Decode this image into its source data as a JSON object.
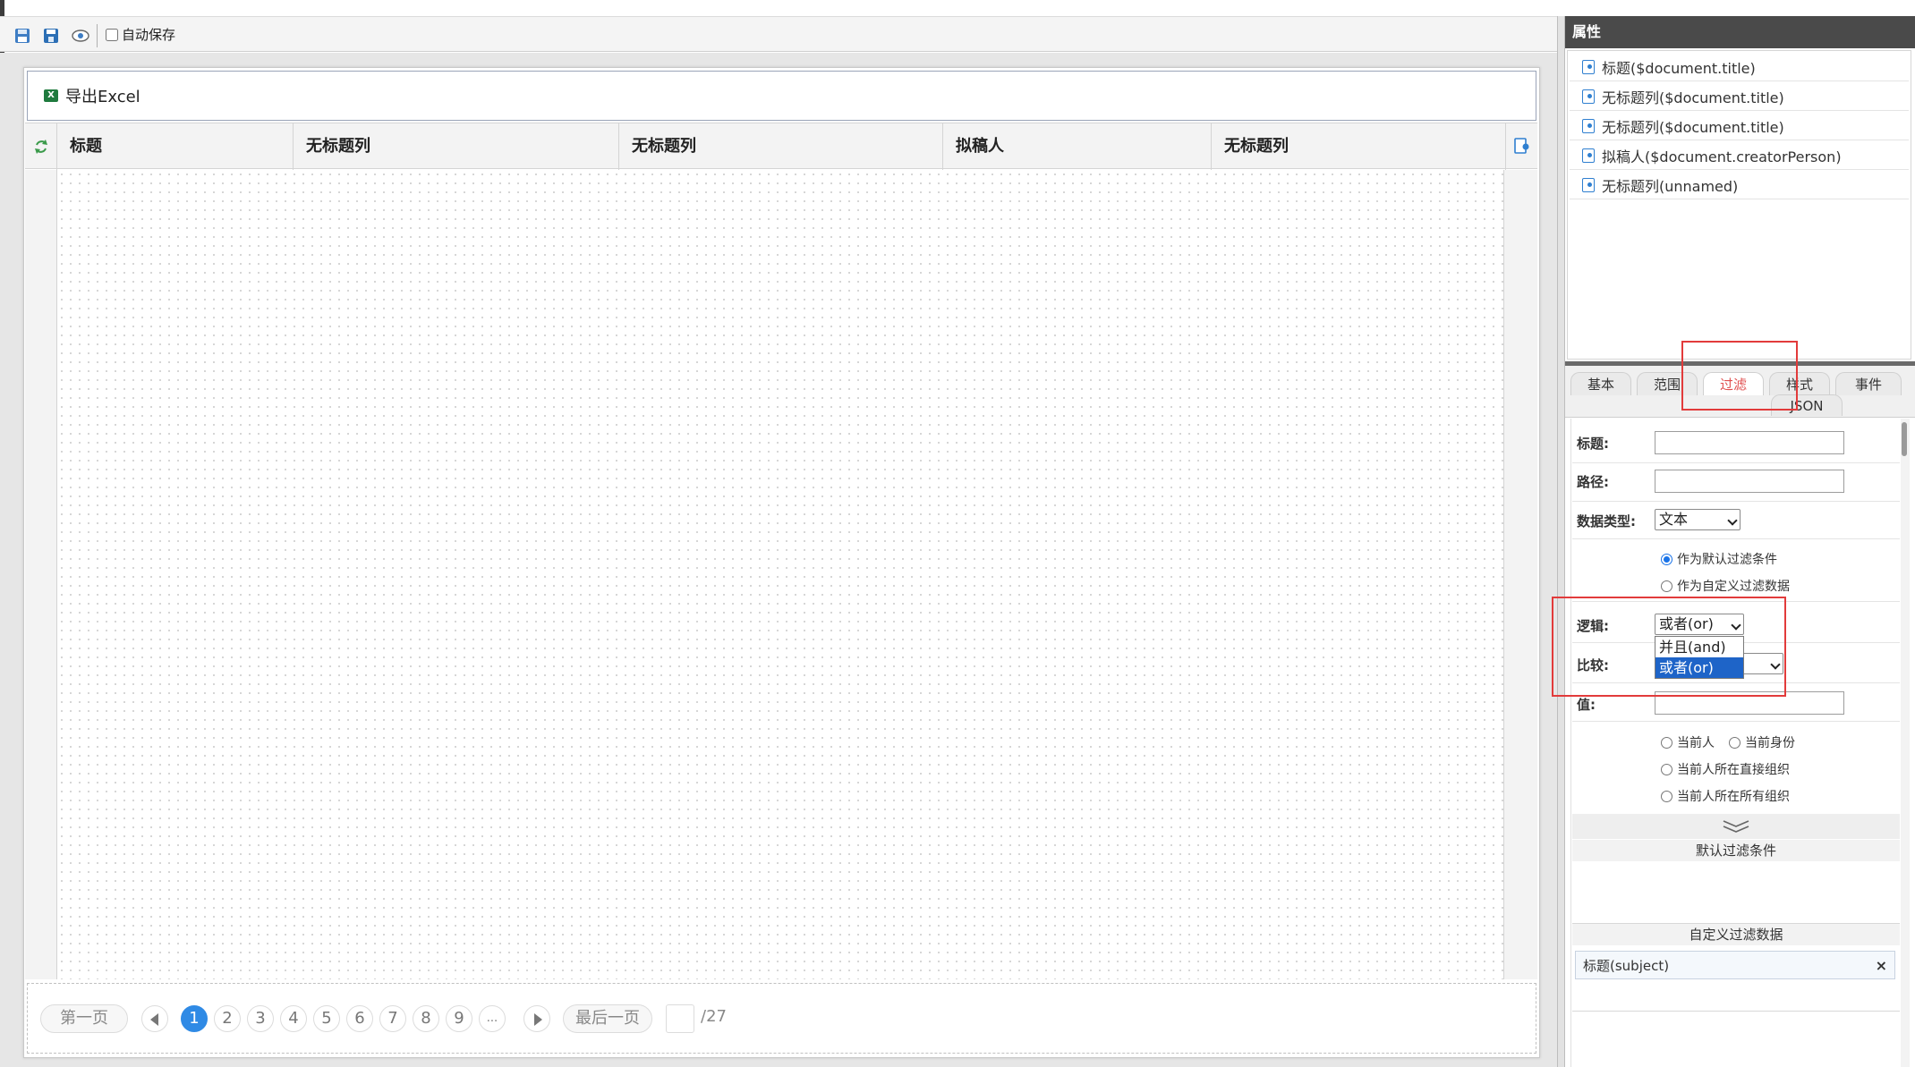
{
  "toolbar": {
    "icons": [
      "save-icon",
      "save-as-icon",
      "preview-icon"
    ],
    "autosave_label": "自动保存",
    "autosave_checked": false
  },
  "view": {
    "export_label": "导出Excel",
    "columns": [
      "标题",
      "无标题列",
      "无标题列",
      "拟稿人",
      "无标题列"
    ]
  },
  "pager": {
    "first": "第一页",
    "last": "最后一页",
    "pages": [
      "1",
      "2",
      "3",
      "4",
      "5",
      "6",
      "7",
      "8",
      "9",
      "..."
    ],
    "current_page": 1,
    "page_input": "",
    "total": "/27"
  },
  "properties": {
    "title": "属性",
    "fields": [
      "标题($document.title)",
      "无标题列($document.title)",
      "无标题列($document.title)",
      "拟稿人($document.creatorPerson)",
      "无标题列(unnamed)"
    ],
    "tabs": [
      "基本",
      "范围",
      "过滤",
      "样式",
      "事件",
      "JSON"
    ],
    "active_tab": "过滤",
    "form": {
      "title_label": "标题:",
      "title_value": "",
      "path_label": "路径:",
      "path_value": "",
      "datatype_label": "数据类型:",
      "datatype_value": "文本",
      "mode_default": "作为默认过滤条件",
      "mode_custom": "作为自定义过滤数据",
      "mode_selected": "作为默认过滤条件",
      "logic_label": "逻辑:",
      "logic_value": "或者(or)",
      "logic_options": [
        "并且(and)",
        "或者(or)"
      ],
      "compare_label": "比较:",
      "compare_value": "",
      "value_label": "值:",
      "value_value": "",
      "current_person": "当前人",
      "current_identity": "当前身份",
      "direct_org": "当前人所在直接组织",
      "all_org": "当前人所在所有组织"
    },
    "default_filter_heading": "默认过滤条件",
    "custom_filter_heading": "自定义过滤数据",
    "custom_filter_item": "标题(subject)",
    "custom_filter_close": "×"
  },
  "colors": {
    "accent_blue": "#2f8ae5",
    "annotation_red": "#e23b3b",
    "selected_option": "#1e64c8"
  }
}
